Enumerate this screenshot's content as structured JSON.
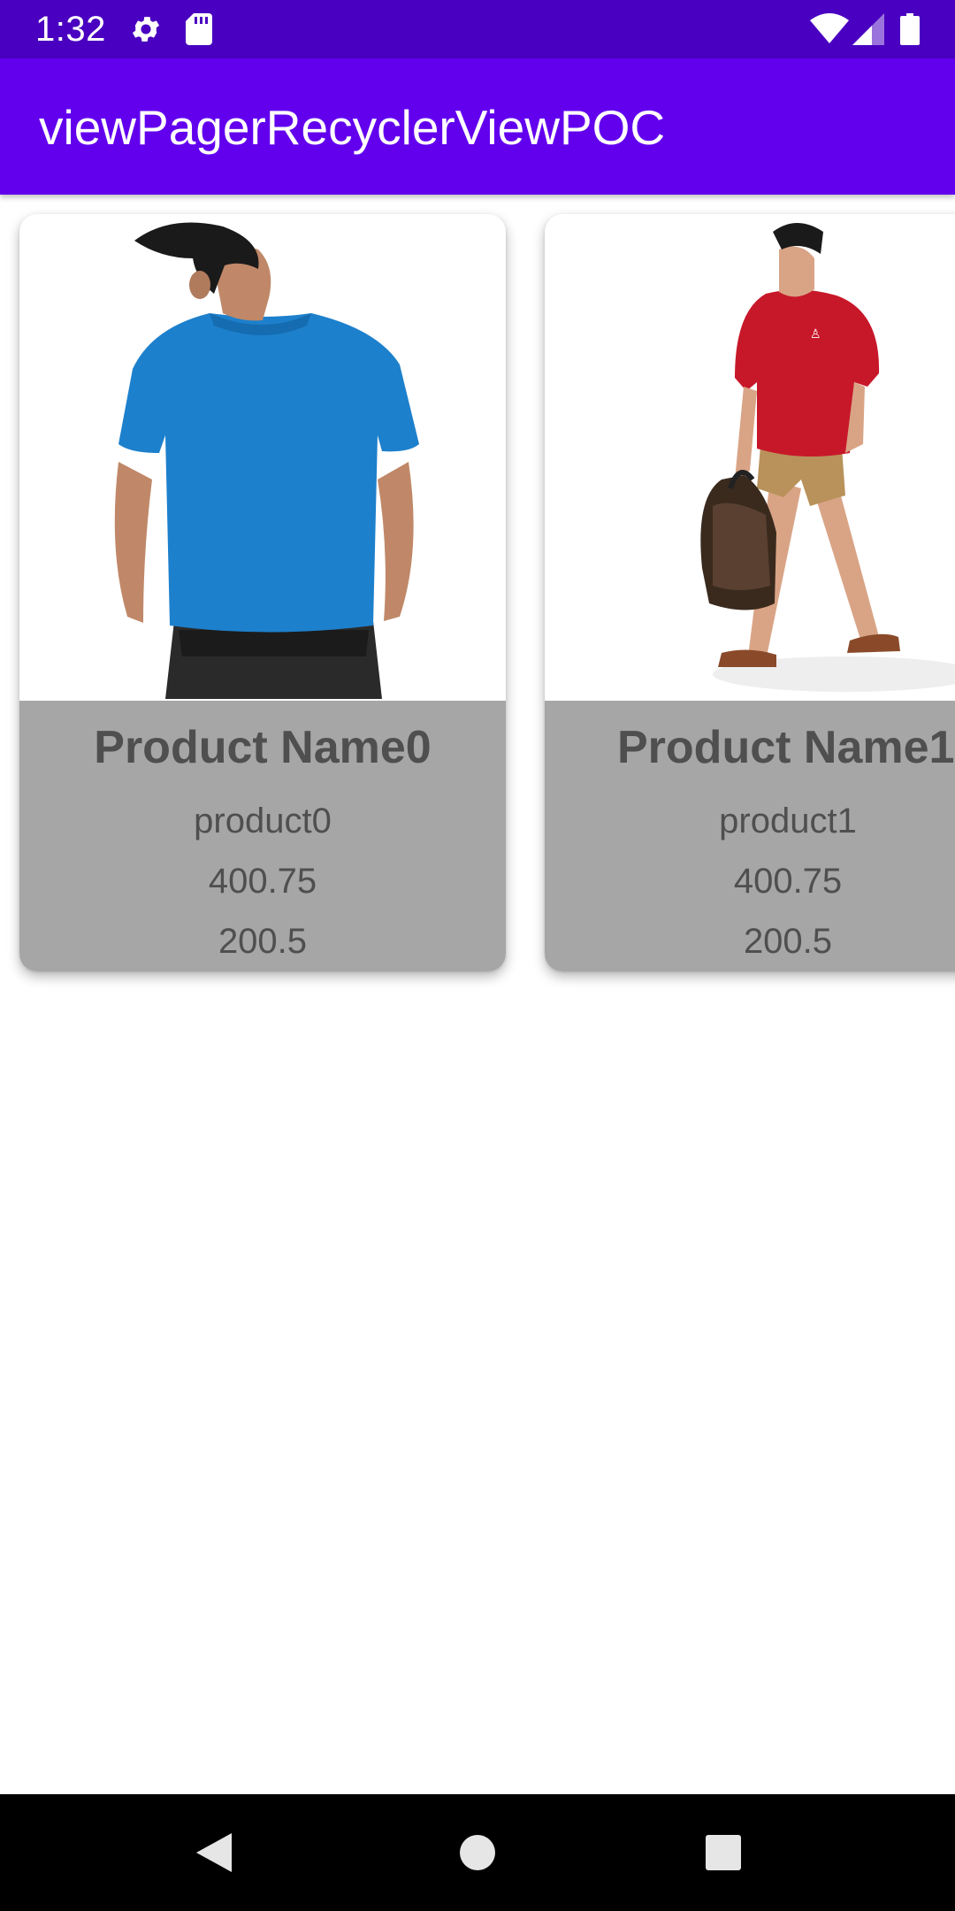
{
  "status_bar": {
    "time": "1:32",
    "icons": [
      "gear-icon",
      "sd-card-icon",
      "wifi-icon",
      "signal-icon",
      "battery-icon"
    ]
  },
  "app_bar": {
    "title": "viewPagerRecyclerViewPOC"
  },
  "products": [
    {
      "name": "Product Name0",
      "id": "product0",
      "price": "400.75",
      "discount_price": "200.5",
      "image": "man-in-blue-polo-shirt-back-view"
    },
    {
      "name": "Product Name1",
      "id": "product1",
      "price": "400.75",
      "discount_price": "200.5",
      "image": "man-in-red-polo-shirt-walking-with-bag"
    }
  ],
  "nav_bar": {
    "buttons": [
      "back-icon",
      "home-icon",
      "recents-icon"
    ]
  },
  "colors": {
    "status_bar": "#4a00c0",
    "app_bar": "#6200ee",
    "card_info_bg": "#a6a6a6",
    "card_text": "#4f4f4f",
    "nav_bar": "#000000"
  }
}
